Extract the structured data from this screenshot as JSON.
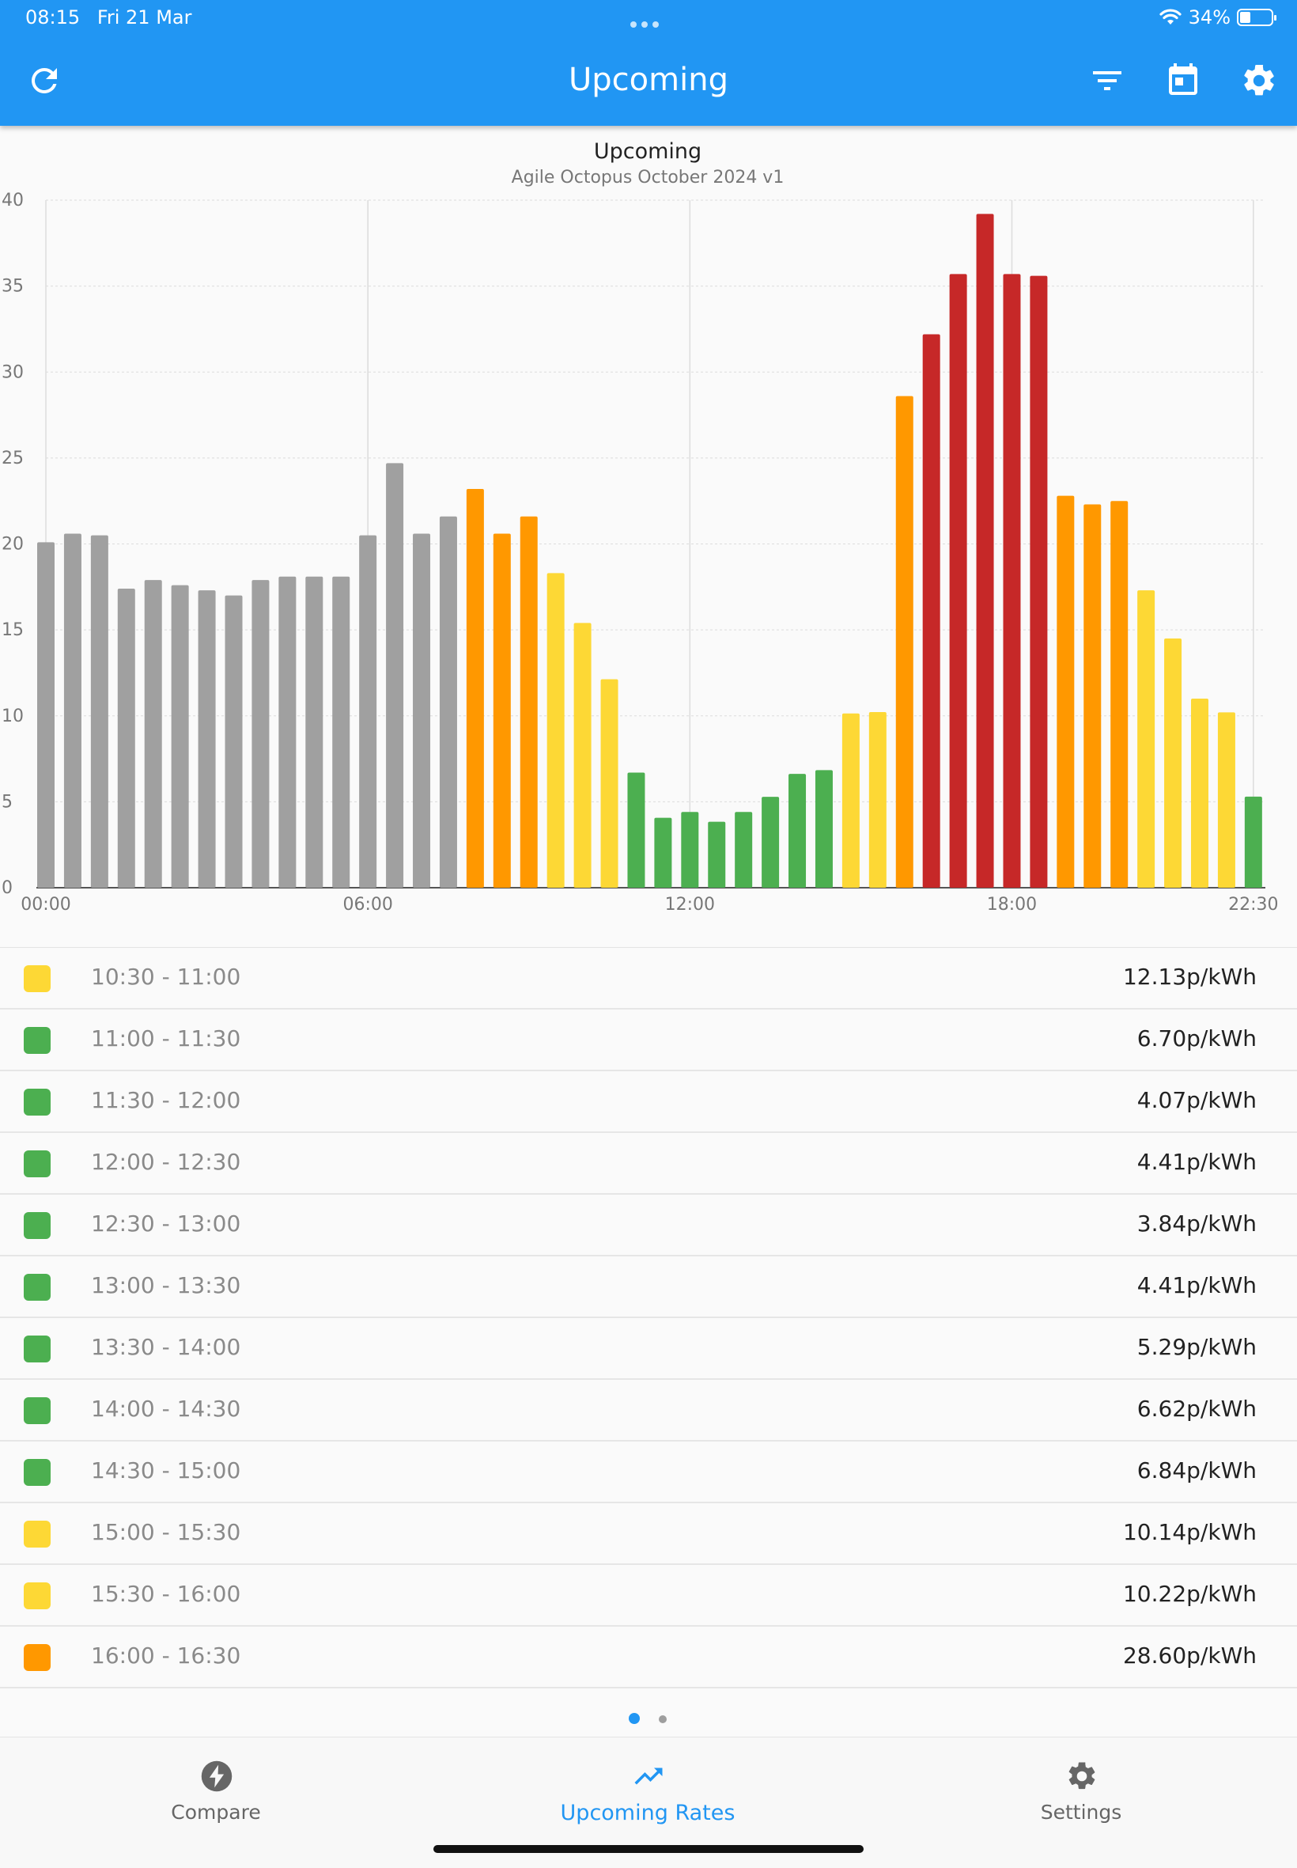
{
  "status_bar": {
    "time": "08:15",
    "date": "Fri 21 Mar",
    "battery": "34%",
    "battery_level": 0.34
  },
  "app_bar": {
    "title": "Upcoming"
  },
  "chart_data": {
    "type": "bar",
    "title": "Upcoming",
    "subtitle": "Agile Octopus October 2024 v1",
    "xlabel": "",
    "ylabel": "",
    "ylim": [
      0,
      40
    ],
    "yticks": [
      0,
      5,
      10,
      15,
      20,
      25,
      30,
      35,
      40
    ],
    "xticks": [
      "00:00",
      "06:00",
      "12:00",
      "18:00",
      "22:30"
    ],
    "grid": true,
    "categories": [
      "00:00",
      "00:30",
      "01:00",
      "01:30",
      "02:00",
      "02:30",
      "03:00",
      "03:30",
      "04:00",
      "04:30",
      "05:00",
      "05:30",
      "06:00",
      "06:30",
      "07:00",
      "07:30",
      "08:00",
      "08:30",
      "09:00",
      "09:30",
      "10:00",
      "10:30",
      "11:00",
      "11:30",
      "12:00",
      "12:30",
      "13:00",
      "13:30",
      "14:00",
      "14:30",
      "15:00",
      "15:30",
      "16:00",
      "16:30",
      "17:00",
      "17:30",
      "18:00",
      "18:30",
      "19:00",
      "19:30",
      "20:00",
      "20:30",
      "21:00",
      "21:30",
      "22:00",
      "22:30"
    ],
    "values": [
      20.1,
      20.6,
      20.5,
      17.4,
      17.9,
      17.6,
      17.3,
      17.0,
      17.9,
      18.1,
      18.1,
      18.1,
      20.5,
      24.7,
      20.6,
      21.6,
      23.2,
      20.6,
      21.6,
      18.3,
      15.4,
      12.13,
      6.7,
      4.07,
      4.41,
      3.84,
      4.41,
      5.29,
      6.62,
      6.84,
      10.14,
      10.22,
      28.6,
      32.2,
      35.7,
      39.2,
      35.7,
      35.6,
      22.8,
      22.3,
      22.5,
      17.3,
      14.5,
      11.0,
      10.2,
      5.3
    ],
    "bar_colors": [
      "gray",
      "gray",
      "gray",
      "gray",
      "gray",
      "gray",
      "gray",
      "gray",
      "gray",
      "gray",
      "gray",
      "gray",
      "gray",
      "gray",
      "gray",
      "gray",
      "orange",
      "orange",
      "orange",
      "yellow",
      "yellow",
      "yellow",
      "green",
      "green",
      "green",
      "green",
      "green",
      "green",
      "green",
      "green",
      "yellow",
      "yellow",
      "orange",
      "red",
      "red",
      "red",
      "red",
      "red",
      "orange",
      "orange",
      "orange",
      "yellow",
      "yellow",
      "yellow",
      "yellow",
      "green"
    ]
  },
  "colors": {
    "gray": "#a0a0a0",
    "orange": "#ff9800",
    "yellow": "#fdd835",
    "green": "#4caf50",
    "red": "#c62828",
    "accent": "#2196f3"
  },
  "rates": [
    {
      "time": "10:30 - 11:00",
      "price": "12.13p/kWh",
      "color": "#fdd835"
    },
    {
      "time": "11:00 - 11:30",
      "price": "6.70p/kWh",
      "color": "#4caf50"
    },
    {
      "time": "11:30 - 12:00",
      "price": "4.07p/kWh",
      "color": "#4caf50"
    },
    {
      "time": "12:00 - 12:30",
      "price": "4.41p/kWh",
      "color": "#4caf50"
    },
    {
      "time": "12:30 - 13:00",
      "price": "3.84p/kWh",
      "color": "#4caf50"
    },
    {
      "time": "13:00 - 13:30",
      "price": "4.41p/kWh",
      "color": "#4caf50"
    },
    {
      "time": "13:30 - 14:00",
      "price": "5.29p/kWh",
      "color": "#4caf50"
    },
    {
      "time": "14:00 - 14:30",
      "price": "6.62p/kWh",
      "color": "#4caf50"
    },
    {
      "time": "14:30 - 15:00",
      "price": "6.84p/kWh",
      "color": "#4caf50"
    },
    {
      "time": "15:00 - 15:30",
      "price": "10.14p/kWh",
      "color": "#fdd835"
    },
    {
      "time": "15:30 - 16:00",
      "price": "10.22p/kWh",
      "color": "#fdd835"
    },
    {
      "time": "16:00 - 16:30",
      "price": "28.60p/kWh",
      "color": "#ff9800"
    },
    {
      "time": "",
      "price": "",
      "color": "#c62828"
    }
  ],
  "bottom_nav": {
    "items": [
      {
        "label": "Compare",
        "icon": "bolt-icon"
      },
      {
        "label": "Upcoming Rates",
        "icon": "trending-up-icon"
      },
      {
        "label": "Settings",
        "icon": "gear-icon"
      }
    ]
  }
}
